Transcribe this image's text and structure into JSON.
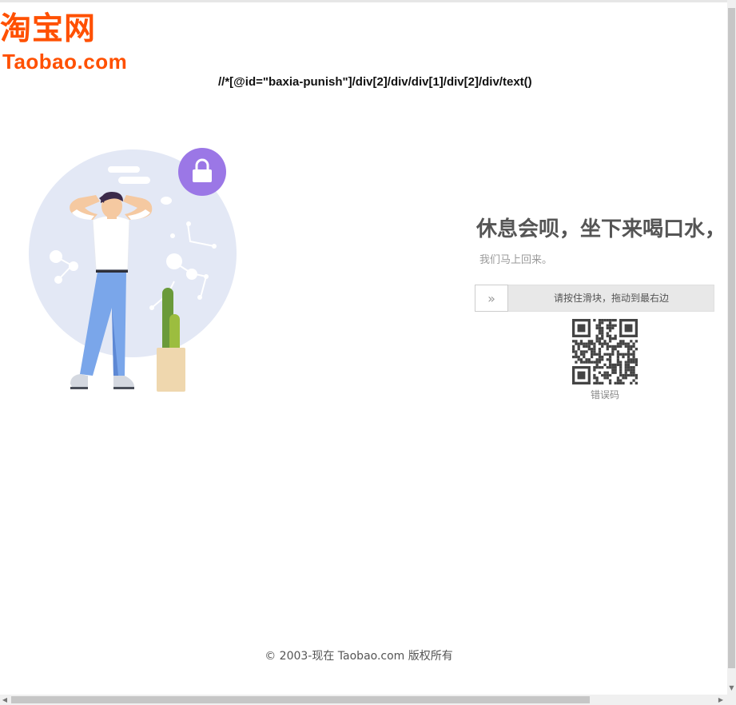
{
  "logo": {
    "cn_text": "淘宝网",
    "en_text": "Taobao.com"
  },
  "debug_xpath": "//*[@id=\"baxia-punish\"]/div[2]/div/div[1]/div[2]/div/text()",
  "message": {
    "headline": "休息会呗，坐下来喝口水，",
    "subline": "我们马上回来。"
  },
  "slider": {
    "handle_glyph": "»",
    "instruction": "请按住滑块，拖动到最右边"
  },
  "qr": {
    "label": "错误码"
  },
  "footer": {
    "copyright": "© 2003-现在 Taobao.com 版权所有"
  },
  "colors": {
    "brand": "#ff5000",
    "illustration_bg": "#e3e8f5",
    "lock_badge": "#9b77e6"
  },
  "icons": {
    "lock": "lock-icon",
    "slider_handle": "double-chevron-right-icon"
  }
}
